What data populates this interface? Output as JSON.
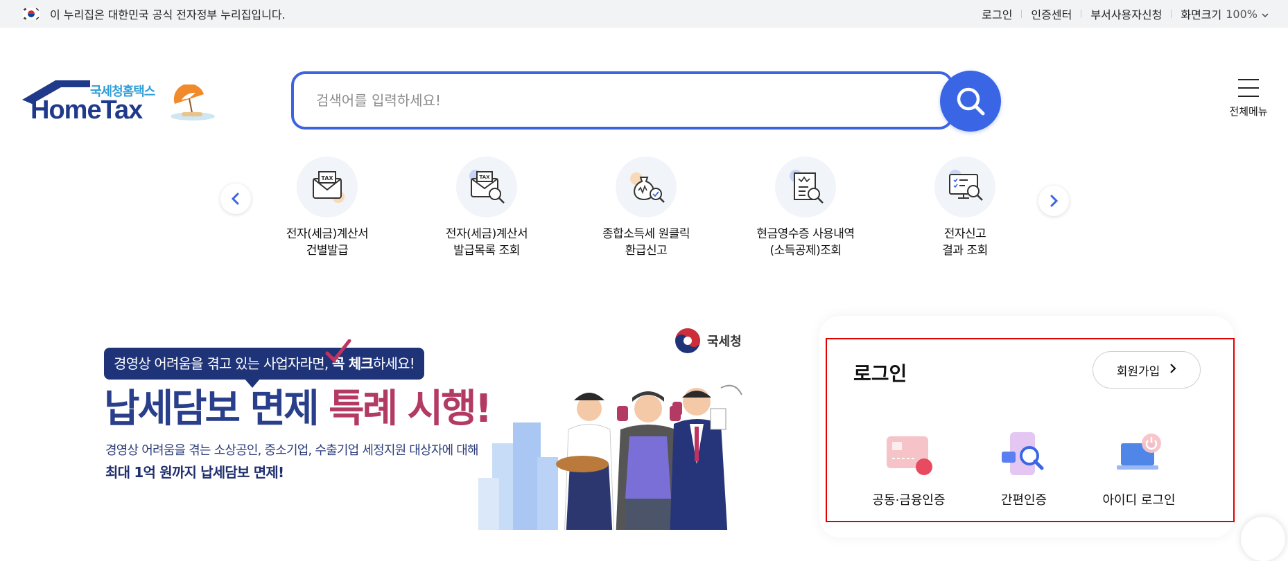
{
  "topbar": {
    "notice": "이 누리집은 대한민국 공식 전자정부 누리집입니다.",
    "links": [
      "로그인",
      "인증센터",
      "부서사용자신청"
    ],
    "zoom_label": "화면크기",
    "zoom_value": "100%"
  },
  "logo": {
    "korean": "국세청홈택스",
    "english": "HomeTax"
  },
  "search": {
    "placeholder": "검색어를 입력하세요!"
  },
  "all_menu": {
    "label": "전체메뉴"
  },
  "quick_menu": [
    {
      "label": "전자(세금)계산서\n건별발급",
      "icon": "tax-envelope-icon"
    },
    {
      "label": "전자(세금)계산서\n발급목록 조회",
      "icon": "tax-invoice-search-icon"
    },
    {
      "label": "종합소득세 원클릭\n환급신고",
      "icon": "money-bag-check-icon"
    },
    {
      "label": "현금영수증 사용내역\n(소득공제)조회",
      "icon": "receipt-search-icon"
    },
    {
      "label": "전자신고\n결과 조회",
      "icon": "monitor-search-icon"
    }
  ],
  "promo": {
    "brand": "국세청",
    "pill_text_before": "경영상 어려움을 겪고 있는 사업자라면, ",
    "pill_text_bold": "꼭 체크",
    "pill_text_after": "하세요!",
    "headline_part1": "납세담보 면제 ",
    "headline_part2": "특례 시행!",
    "sub_line1": "경영상 어려움을 겪는 소상공인, 중소기업, 수출기업 세정지원 대상자에 대해",
    "sub_line2": "최대 1억 원까지 납세담보 면제!"
  },
  "login": {
    "title": "로그인",
    "signup_label": "회원가입",
    "options": [
      {
        "label": "공동·금융인증",
        "icon": "certificate-card-icon"
      },
      {
        "label": "간편인증",
        "icon": "simple-auth-icon"
      },
      {
        "label": "아이디 로그인",
        "icon": "laptop-power-icon"
      }
    ]
  },
  "colors": {
    "primary": "#3a66e5",
    "navy": "#1f3478",
    "highlight_border": "#e00000"
  }
}
